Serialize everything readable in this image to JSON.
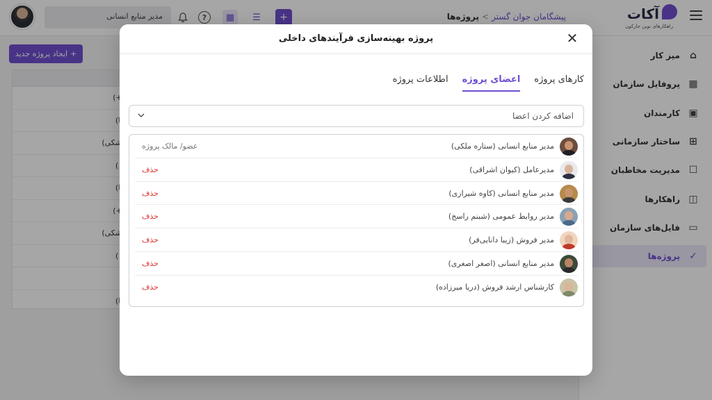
{
  "app": {
    "logo_text": "آکات",
    "logo_subtitle": "راهکارهای نوین جارکون"
  },
  "breadcrumb": {
    "org": "پیشگامان جوان گستر",
    "separator": ">",
    "current": "پروژه‌ها"
  },
  "header": {
    "user_role": "مدیر منابع انسانی",
    "icons": [
      "bell-icon",
      "help-icon",
      "grid-icon",
      "tasks-icon",
      "plus-icon"
    ]
  },
  "sidebar": {
    "items": [
      {
        "label": "میز کار",
        "icon": "home-icon",
        "glyph": "⌂",
        "active": false
      },
      {
        "label": "پروفایل سازمان",
        "icon": "building-icon",
        "glyph": "▦",
        "active": false
      },
      {
        "label": "کارمندان",
        "icon": "id-card-icon",
        "glyph": "▣",
        "active": false
      },
      {
        "label": "ساختار سازمانی",
        "icon": "org-chart-icon",
        "glyph": "⊞",
        "active": false
      },
      {
        "label": "مدیریت مخاطبان",
        "icon": "contact-icon",
        "glyph": "☐",
        "active": false
      },
      {
        "label": "راهکارها",
        "icon": "solutions-icon",
        "glyph": "◫",
        "active": false
      },
      {
        "label": "فایل‌های سازمان",
        "icon": "folder-icon",
        "glyph": "▭",
        "active": false
      },
      {
        "label": "پروژه‌ها",
        "icon": "clipboard-icon",
        "glyph": "✓",
        "active": true
      }
    ]
  },
  "content": {
    "new_project_label": "ایجاد پروژه جدید",
    "bg_rows": [
      "(۱+)",
      "نها)",
      "کوشکی)",
      ")",
      "نها)",
      "(۱+)",
      "کوشکی)",
      ")",
      "",
      "تها)"
    ]
  },
  "modal": {
    "title": "پروژه بهینه‌سازی فرآیندهای داخلی",
    "tabs": [
      {
        "label": "کارهای پروژه",
        "active": false
      },
      {
        "label": "اعضای پروژه",
        "active": true
      },
      {
        "label": "اطلاعات پروژه",
        "active": false
      }
    ],
    "add_members_placeholder": "اضافه کردن اعضا",
    "members": [
      {
        "name": "مدیر منابع انسانی (ستاره ملکی)",
        "action": "عضو/ مالک پروژه",
        "action_type": "owner",
        "skin": "#c99272",
        "clothes": "#1e1e24",
        "bg": "#6b4d3d"
      },
      {
        "name": "مدیرعامل (کیوان اشراقی)",
        "action": "حذف",
        "action_type": "delete",
        "skin": "#d9b49a",
        "clothes": "#2c3040",
        "bg": "#e9e9ee"
      },
      {
        "name": "مدیر منابع انسانی (کاوه شیرازی)",
        "action": "حذف",
        "action_type": "delete",
        "skin": "#c8936b",
        "clothes": "#3a3a3a",
        "bg": "#b58a4c"
      },
      {
        "name": "مدیر روابط عمومی (شبنم راسخ)",
        "action": "حذف",
        "action_type": "delete",
        "skin": "#d7a98c",
        "clothes": "#4a6a8a",
        "bg": "#8aa1b5"
      },
      {
        "name": "مدیر فروش (زیبا دانایی‌فر)",
        "action": "حذف",
        "action_type": "delete",
        "skin": "#e1b79b",
        "clothes": "#c0392b",
        "bg": "#f0d5c0"
      },
      {
        "name": "مدیر منابع انسانی (اصغر اصغری)",
        "action": "حذف",
        "action_type": "delete",
        "skin": "#b88466",
        "clothes": "#2a2a2a",
        "bg": "#3d4a3a"
      },
      {
        "name": "کارشناس ارشد فروش (دریا میرزاده)",
        "action": "حذف",
        "action_type": "delete",
        "skin": "#d9b59a",
        "clothes": "#7d8a6a",
        "bg": "#c9c3a8"
      }
    ]
  }
}
